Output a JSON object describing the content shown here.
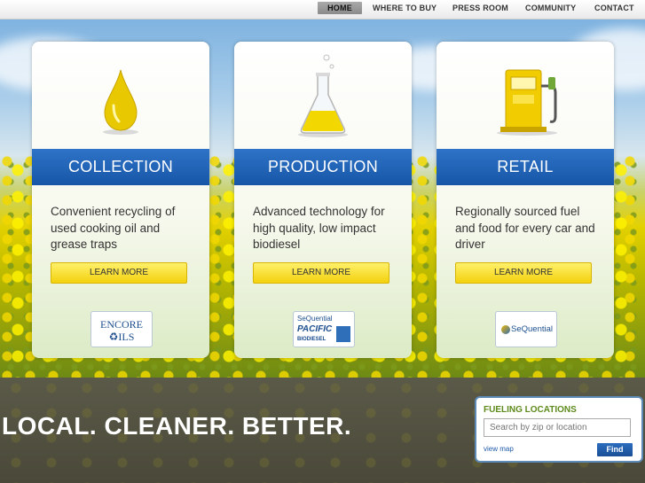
{
  "nav": {
    "items": [
      {
        "label": "HOME",
        "active": true
      },
      {
        "label": "WHERE TO BUY",
        "active": false
      },
      {
        "label": "PRESS ROOM",
        "active": false
      },
      {
        "label": "COMMUNITY",
        "active": false
      },
      {
        "label": "CONTACT",
        "active": false
      }
    ]
  },
  "cards": [
    {
      "title": "COLLECTION",
      "description": "Convenient recycling of used cooking oil and grease traps",
      "button": "LEARN MORE",
      "icon": "oil-drop-icon",
      "logo": {
        "line1": "ENCORE",
        "line2": "♻ILS"
      }
    },
    {
      "title": "PRODUCTION",
      "description": "Advanced technology for high quality, low impact biodiesel",
      "button": "LEARN MORE",
      "icon": "flask-icon",
      "logo": {
        "line1": "SeQuential",
        "line2": "PACIFIC",
        "line3": "BIODIESEL"
      }
    },
    {
      "title": "RETAIL",
      "description": "Regionally sourced fuel and food for every car and driver",
      "button": "LEARN MORE",
      "icon": "fuel-pump-icon",
      "logo": {
        "line1": "SeQuential"
      }
    }
  ],
  "tagline": "LOCAL. CLEANER. BETTER.",
  "fueling": {
    "title": "FUELING LOCATIONS",
    "placeholder": "Search by zip or location",
    "view_map": "view map",
    "find": "Find"
  },
  "colors": {
    "accent_blue": "#1f63b8",
    "button_yellow": "#f7dc22",
    "green_title": "#5d8b1b"
  }
}
